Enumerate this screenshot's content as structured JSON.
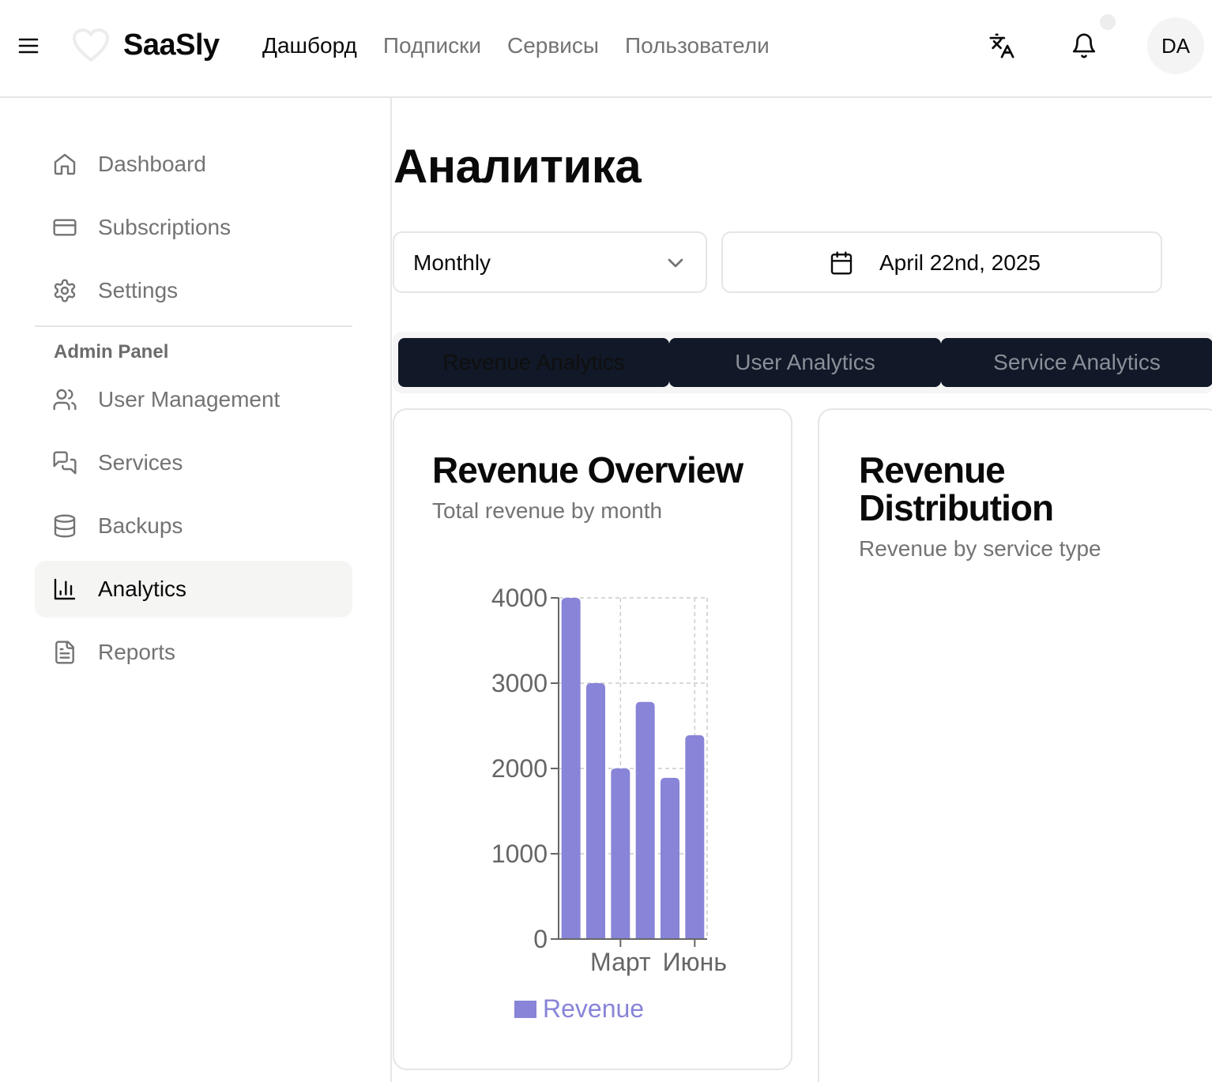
{
  "header": {
    "brand": "SaaSly",
    "nav": [
      "Дашборд",
      "Подписки",
      "Сервисы",
      "Пользователи"
    ],
    "active_nav": "Дашборд",
    "avatar_initials": "DA"
  },
  "sidebar": {
    "items": [
      {
        "label": "Dashboard",
        "icon": "home-icon"
      },
      {
        "label": "Subscriptions",
        "icon": "credit-card-icon"
      },
      {
        "label": "Settings",
        "icon": "gear-icon"
      }
    ],
    "section_title": "Admin Panel",
    "admin_items": [
      {
        "label": "User Management",
        "icon": "users-icon"
      },
      {
        "label": "Services",
        "icon": "chat-bubbles-icon"
      },
      {
        "label": "Backups",
        "icon": "database-icon"
      },
      {
        "label": "Analytics",
        "icon": "bar-chart-icon",
        "active": true
      },
      {
        "label": "Reports",
        "icon": "document-icon"
      }
    ]
  },
  "main": {
    "title": "Аналитика",
    "period_select": "Monthly",
    "date": "April 22nd, 2025",
    "tabs": [
      "Revenue Analytics",
      "User Analytics",
      "Service Analytics"
    ],
    "active_tab": "Revenue Analytics"
  },
  "cards": {
    "overview": {
      "title": "Revenue Overview",
      "subtitle": "Total revenue by month"
    },
    "distribution": {
      "title": "Revenue Distribution",
      "subtitle": "Revenue by service type"
    }
  },
  "colors": {
    "bar": "#8884d8",
    "tab_bg": "#111827"
  },
  "chart_data": {
    "type": "bar",
    "categories": [
      "",
      "",
      "Март",
      "",
      "",
      "Июнь"
    ],
    "series": [
      {
        "name": "Revenue",
        "values": [
          4000,
          3000,
          2000,
          2780,
          1890,
          2390
        ]
      }
    ],
    "ylim": [
      0,
      4000
    ],
    "yticks": [
      0,
      1000,
      2000,
      3000,
      4000
    ],
    "xtick_labels_shown": [
      "Март",
      "Июнь"
    ],
    "grid": true,
    "legend": "bottom"
  }
}
